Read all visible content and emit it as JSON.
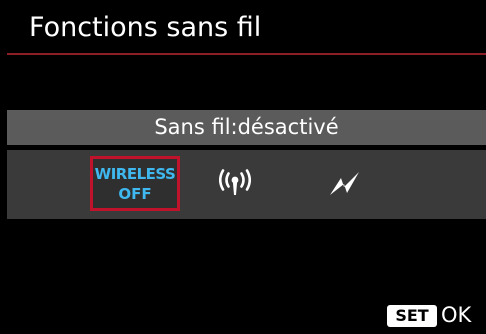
{
  "header": {
    "title": "Fonctions sans fil"
  },
  "status": {
    "text": "Sans fil:désactivé"
  },
  "options": {
    "wireless_off": {
      "line1": "WIRELESS",
      "line2": "OFF",
      "selected": true
    },
    "wifi_icon": "wifi-antenna-icon",
    "bluetooth_icon": "bluetooth-lightning-icon"
  },
  "footer": {
    "set_label": "SET",
    "ok_label": "OK"
  },
  "colors": {
    "background": "#000000",
    "accent_red": "#c0122b",
    "header_rule": "#8c1f26",
    "status_bar": "#5b5b5b",
    "options_bar": "#3a3a3a",
    "wireless_off_text": "#3fb7ef"
  }
}
